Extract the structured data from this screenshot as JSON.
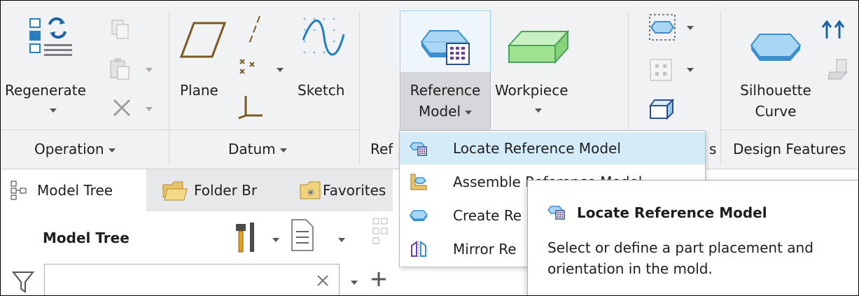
{
  "ribbon": {
    "operation": {
      "regenerate_label": "Regenerate",
      "group_label": "Operation"
    },
    "datum": {
      "plane_label": "Plane",
      "sketch_label": "Sketch",
      "group_label": "Datum"
    },
    "reference_model": {
      "line1": "Reference",
      "line2": "Model"
    },
    "workpiece_label": "Workpiece",
    "ref_group_label_partial": "Ref",
    "partial_group_s": "s",
    "design_features": {
      "silhouette_line1": "Silhouette",
      "silhouette_line2": "Curve",
      "group_label": "Design Features"
    }
  },
  "dropdown": {
    "items": [
      {
        "label": "Locate Reference Model"
      },
      {
        "label": "Assemble Reference Model"
      },
      {
        "label": "Create Re"
      },
      {
        "label": "Mirror Re"
      }
    ]
  },
  "tooltip": {
    "title": "Locate Reference Model",
    "line1": "Select or define a part placement and",
    "line2": "orientation in the mold."
  },
  "tabs": [
    {
      "label": "Model Tree"
    },
    {
      "label": "Folder Br"
    },
    {
      "label": "Favorites"
    }
  ],
  "panel": {
    "title": "Model Tree"
  },
  "colors": {
    "accent": "#9fd1ef",
    "selected_item": "#d4ecf8",
    "ribbon_bg": "#f1f2f4"
  }
}
